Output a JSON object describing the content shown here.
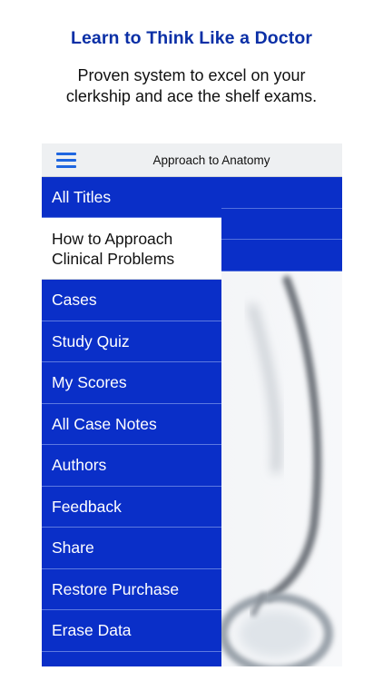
{
  "promo": {
    "headline": "Learn to Think Like a Doctor",
    "subtitle_line1": "Proven system to excel on your",
    "subtitle_line2": "clerkship and ace the shelf exams."
  },
  "nav": {
    "title": "Approach to Anatomy",
    "menu_icon": "hamburger-menu-icon"
  },
  "menu": {
    "items": [
      {
        "label": "All Titles"
      },
      {
        "label_line1": "How to Approach",
        "label_line2": "Clinical Problems",
        "selected": true
      },
      {
        "label": "Cases"
      },
      {
        "label": "Study Quiz"
      },
      {
        "label": "My Scores"
      },
      {
        "label": "All Case Notes"
      },
      {
        "label": "Authors"
      },
      {
        "label": "Feedback"
      },
      {
        "label": "Share"
      },
      {
        "label": "Restore Purchase"
      },
      {
        "label": "Erase Data"
      }
    ]
  },
  "colors": {
    "headline": "#0a2fa6",
    "menu_background": "#0a2fc8",
    "selected_background": "#ffffff",
    "accent": "#1f66e0"
  },
  "background_image": "stethoscope"
}
